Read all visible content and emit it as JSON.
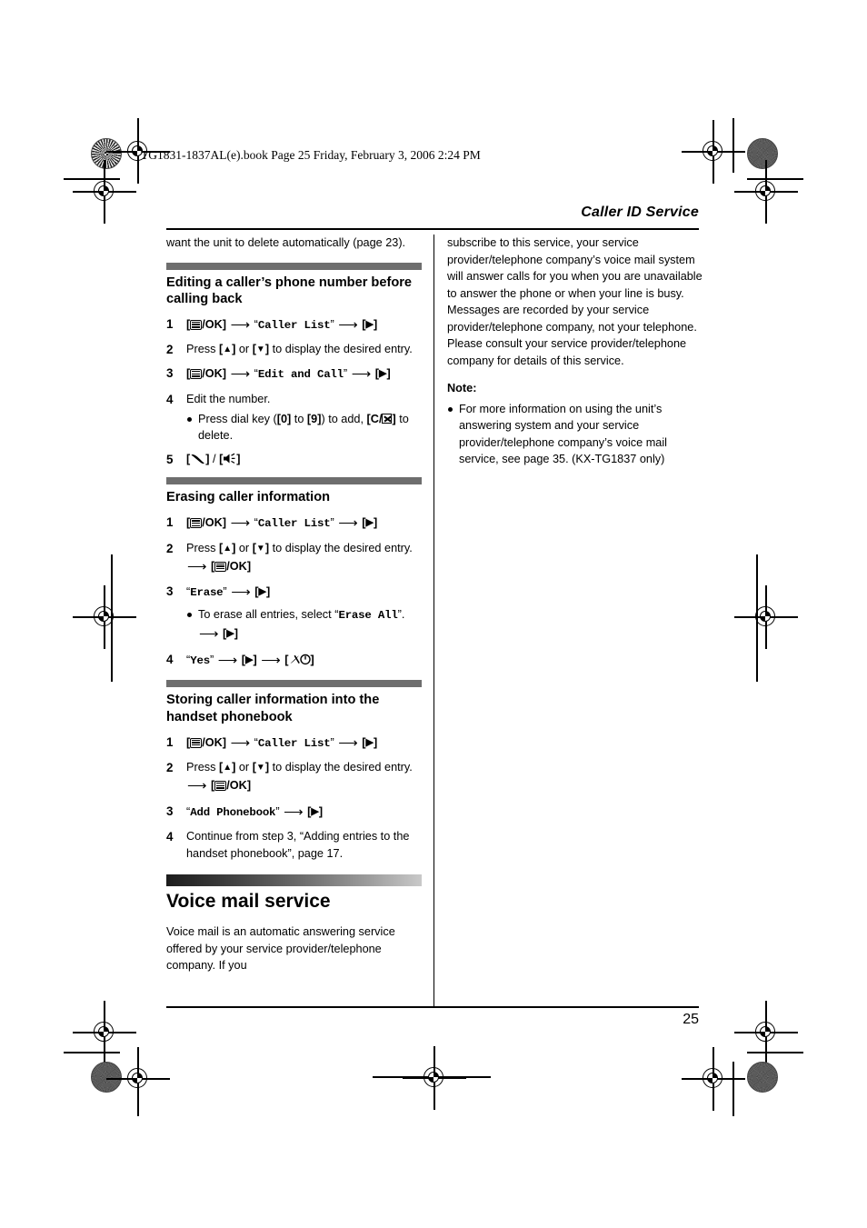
{
  "print_banner": "TG1831-1837AL(e).book  Page 25  Friday, February 3, 2006  2:24 PM",
  "running_head": "Caller ID Service",
  "folio": "25",
  "left_column": {
    "continued_paragraph": "want the unit to delete automatically (page 23).",
    "sections": [
      {
        "heading": "Editing a caller’s phone number before calling back",
        "steps": [
          {
            "num": "1",
            "kind": "keyseq",
            "parts": [
              "[menu/OK]",
              "arrow",
              "“Caller List”",
              "arrow",
              "[▶]"
            ]
          },
          {
            "num": "2",
            "kind": "text",
            "text": "Press [▲] or [▼] to display the desired entry."
          },
          {
            "num": "3",
            "kind": "keyseq",
            "parts": [
              "[menu/OK]",
              "arrow",
              "“Edit and Call”",
              "arrow",
              "[▶]"
            ]
          },
          {
            "num": "4",
            "kind": "text",
            "text": "Edit the number.",
            "bullets": [
              "Press dial key ([0] to [9]) to add, [C/⌧] to delete."
            ]
          },
          {
            "num": "5",
            "kind": "keyseq",
            "parts": [
              "[talk]",
              "/",
              "[speaker]"
            ]
          }
        ]
      },
      {
        "heading": "Erasing caller information",
        "steps": [
          {
            "num": "1",
            "kind": "keyseq",
            "parts": [
              "[menu/OK]",
              "arrow",
              "“Caller List”",
              "arrow",
              "[▶]"
            ]
          },
          {
            "num": "2",
            "kind": "text",
            "text": "Press [▲] or [▼] to display the desired entry. → [menu/OK]"
          },
          {
            "num": "3",
            "kind": "keyseq",
            "parts": [
              "“Erase”",
              "arrow",
              "[▶]"
            ],
            "bullets": [
              "To erase all entries, select “Erase All”. → [▶]"
            ]
          },
          {
            "num": "4",
            "kind": "keyseq",
            "parts": [
              "“Yes”",
              "arrow",
              "[▶]",
              "arrow",
              "[off]"
            ]
          }
        ]
      },
      {
        "heading": "Storing caller information into the handset phonebook",
        "steps": [
          {
            "num": "1",
            "kind": "keyseq",
            "parts": [
              "[menu/OK]",
              "arrow",
              "“Caller List”",
              "arrow",
              "[▶]"
            ]
          },
          {
            "num": "2",
            "kind": "text",
            "text": "Press [▲] or [▼] to display the desired entry. → [menu/OK]"
          },
          {
            "num": "3",
            "kind": "keyseq",
            "parts": [
              "“Add Phonebook”",
              "arrow",
              "[▶]"
            ]
          },
          {
            "num": "4",
            "kind": "text",
            "text": "Continue from step 3, “Adding entries to the handset phonebook”, page 17."
          }
        ]
      }
    ],
    "major_section": {
      "heading": "Voice mail service",
      "paragraph": "Voice mail is an automatic answering service offered by your service provider/telephone company. If you"
    }
  },
  "right_column": {
    "continued_paragraph": "subscribe to this service, your service provider/telephone company’s voice mail system will answer calls for you when you are unavailable to answer the phone or when your line is busy. Messages are recorded by your service provider/telephone company, not your telephone. Please consult your service provider/telephone company for details of this service.",
    "note_title": "Note:",
    "note_items": [
      "For more information on using the unit’s answering system and your service provider/telephone company’s voice mail service, see page 35. (KX-TG1837 only)"
    ]
  },
  "strings": {
    "caller_list": "Caller List",
    "edit_and_call": "Edit and Call",
    "erase": "Erase",
    "erase_all": "Erase All",
    "yes": "Yes",
    "add_phonebook": "Add Phonebook"
  },
  "step_text": {
    "s1_2": "Press",
    "s1_2b": "or",
    "s1_2c": "to display the desired entry.",
    "s1_4": "Edit the number.",
    "s1_4b_pre": "Press dial key (",
    "s1_4b_mid": "to",
    "s1_4b_post": ") to add,",
    "s1_4b_end": "to delete.",
    "s2_3b_pre": "To erase all entries, select",
    "s3_4": "Continue from step 3, “Adding entries to the handset phonebook”, page 17."
  },
  "keys": {
    "menu_ok": "/OK",
    "zero": "0",
    "nine": "9",
    "c": "C/",
    "arrow_right": "▶",
    "arrow_up": "▲",
    "arrow_down": "▼"
  },
  "colors": {
    "subsection_bar": "#6e6e6e",
    "rule": "#000000",
    "page_bg": "#ffffff"
  }
}
